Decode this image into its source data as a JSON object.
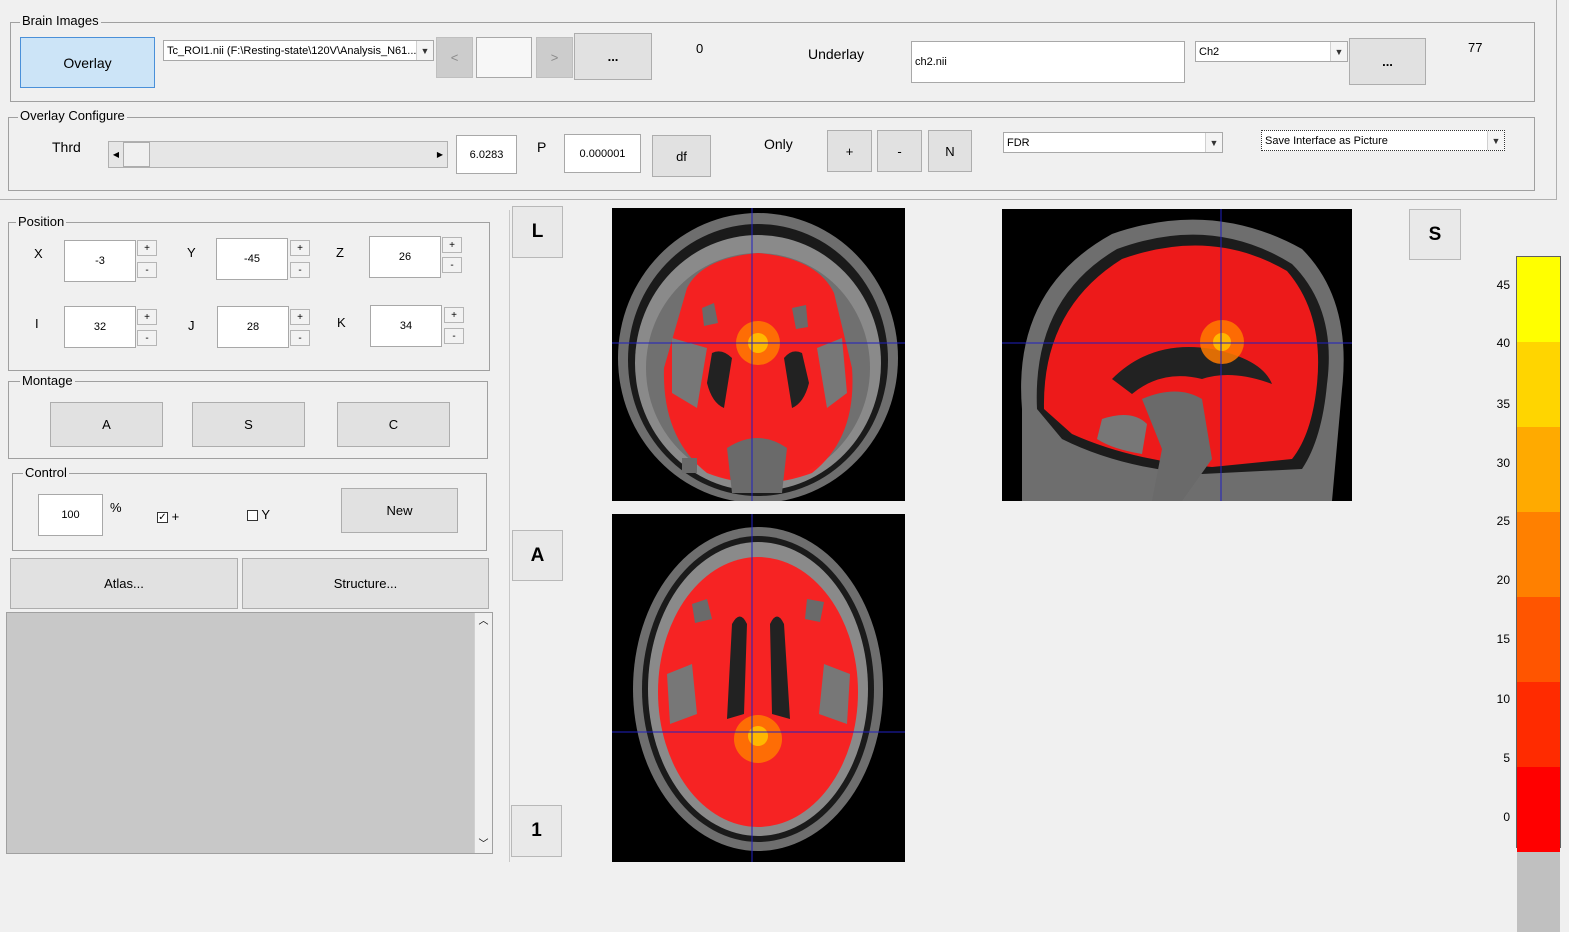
{
  "brain_images": {
    "title": "Brain Images",
    "overlay_button": "Overlay",
    "overlay_file": "Tc_ROI1.nii (F:\\Resting-state\\120V\\Analysis_N61...",
    "prev": "<",
    "next": ">",
    "browse1": "...",
    "overlay_count": "0",
    "underlay_label": "Underlay",
    "underlay_file": "ch2.nii",
    "underlay_template": "Ch2",
    "browse2": "...",
    "underlay_count": "77"
  },
  "overlay_config": {
    "title": "Overlay Configure",
    "thrd_label": "Thrd",
    "thrd_value": "6.0283",
    "p_label": "P",
    "p_value": "0.000001",
    "df_button": "df",
    "only_label": "Only",
    "plus": "+",
    "minus": "-",
    "n": "N",
    "correction": "FDR",
    "save_option": "Save Interface as Picture"
  },
  "position": {
    "title": "Position",
    "x_label": "X",
    "x": "-3",
    "y_label": "Y",
    "y": "-45",
    "z_label": "Z",
    "z": "26",
    "i_label": "I",
    "i": "32",
    "j_label": "J",
    "j": "28",
    "k_label": "K",
    "k": "34",
    "plus": "+",
    "minus": "-"
  },
  "montage": {
    "title": "Montage",
    "a": "A",
    "s": "S",
    "c": "C"
  },
  "control": {
    "title": "Control",
    "percent_value": "100",
    "percent_sign": "%",
    "cross_label": "+",
    "y_label": "Y",
    "cross_checked": true,
    "y_checked": false,
    "new_button": "New"
  },
  "atlas_button": "Atlas...",
  "structure_button": "Structure...",
  "views": {
    "l": "L",
    "a": "A",
    "s": "S",
    "one": "1"
  },
  "colorbar": {
    "ticks": [
      "45",
      "40",
      "35",
      "30",
      "25",
      "20",
      "15",
      "10",
      "5",
      "0"
    ],
    "colors": [
      "#ffff00",
      "#ffd500",
      "#ffaa00",
      "#ff8000",
      "#ff5500",
      "#ff2b00",
      "#ff0000",
      "#c0c0c0"
    ]
  }
}
